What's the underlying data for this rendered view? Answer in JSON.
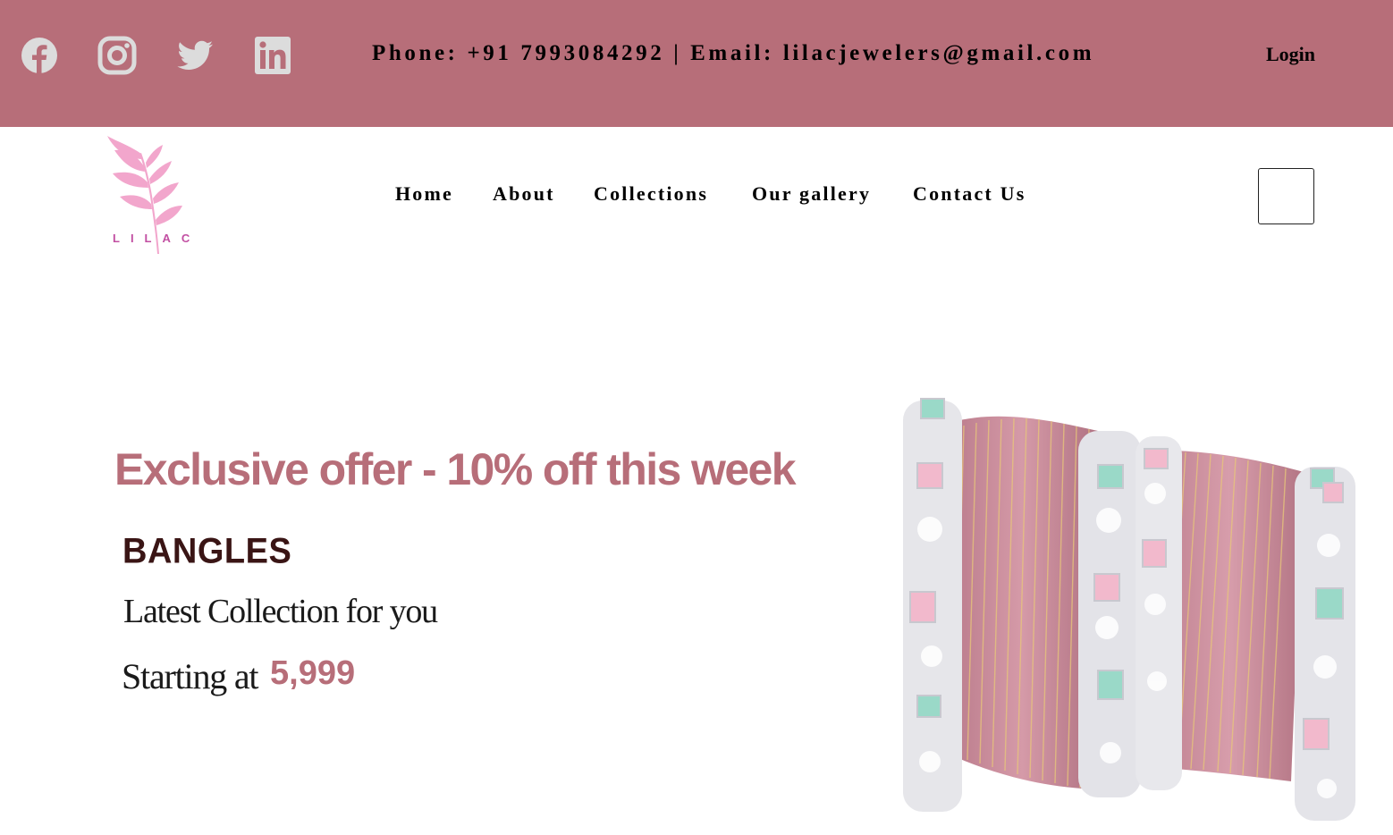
{
  "topbar": {
    "background": "#b76e79",
    "social": [
      {
        "name": "facebook",
        "icon": "facebook-icon"
      },
      {
        "name": "instagram",
        "icon": "instagram-icon"
      },
      {
        "name": "twitter",
        "icon": "twitter-icon"
      },
      {
        "name": "linkedin",
        "icon": "linkedin-icon"
      }
    ],
    "contact_text": "Phone: +91 7993084292 | Email: lilacjewelers@gmail.com",
    "login_label": "Login"
  },
  "brand": {
    "logo_text": "LILAC",
    "logo_color": "#f2a6cc"
  },
  "nav": {
    "items": [
      {
        "label": "Home"
      },
      {
        "label": "About"
      },
      {
        "label": "Collections"
      },
      {
        "label": "Our gallery"
      },
      {
        "label": "Contact Us"
      }
    ]
  },
  "hero": {
    "offer": "Exclusive offer - 10% off this week",
    "category": "BANGLES",
    "subtitle": "Latest Collection for you",
    "starting_label": "Starting at",
    "price": "5,999",
    "accent": "#b76e79"
  }
}
